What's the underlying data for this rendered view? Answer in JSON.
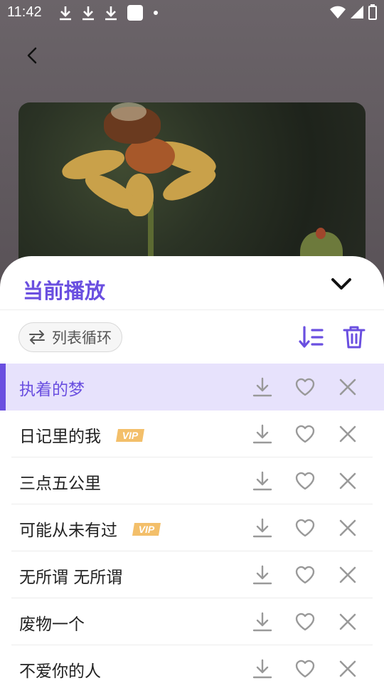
{
  "status_bar": {
    "time": "11:42",
    "left_icons": [
      "download-icon",
      "download-icon",
      "download-icon",
      "app-square-icon",
      "dot-icon"
    ],
    "right_icons": [
      "wifi-icon",
      "signal-icon",
      "battery-icon"
    ]
  },
  "header": {
    "back_icon": "chevron-left-icon"
  },
  "sheet": {
    "title": "当前播放",
    "collapse_icon": "chevron-down-icon",
    "play_mode": {
      "icon": "repeat-icon",
      "label": "列表循环"
    },
    "sort_icon": "sort-icon",
    "clear_icon": "trash-icon",
    "songs": [
      {
        "title": "执着的梦",
        "vip": false,
        "active": true
      },
      {
        "title": "日记里的我",
        "vip": true,
        "active": false
      },
      {
        "title": "三点五公里",
        "vip": false,
        "active": false
      },
      {
        "title": "可能从未有过",
        "vip": true,
        "active": false
      },
      {
        "title": "无所谓 无所谓",
        "vip": false,
        "active": false
      },
      {
        "title": "废物一个",
        "vip": false,
        "active": false
      },
      {
        "title": "不爱你的人",
        "vip": false,
        "active": false
      }
    ],
    "vip_label": "VIP"
  },
  "colors": {
    "accent": "#6a4fe0",
    "active_row_bg": "#e7e2fc",
    "vip_badge": "#f3bf6a",
    "icon_gray": "#999999"
  }
}
